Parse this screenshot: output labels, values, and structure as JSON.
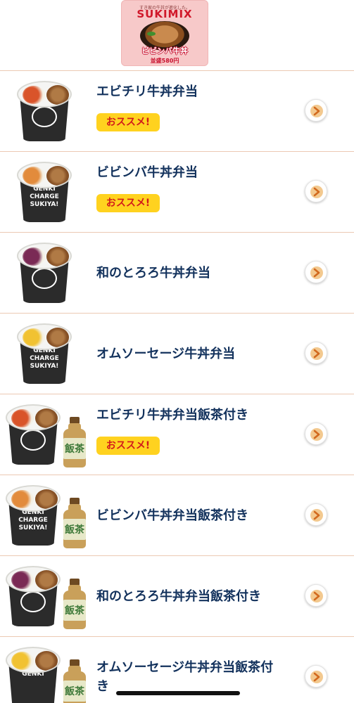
{
  "banner": {
    "tagline": "すき家の牛丼が進化した。",
    "logo": "SUKIMIX",
    "dish": "ビビンバ牛丼",
    "price": "並盛580円"
  },
  "colors": {
    "title": "#12315c",
    "badge_bg": "#ffd21f",
    "badge_text": "#d21a1a",
    "divider": "#ecc9b3"
  },
  "items": [
    {
      "title": "エビチリ牛丼弁当",
      "badge": "おススメ!",
      "left_color": "#d9542a",
      "has_tea": false,
      "cup_text": ""
    },
    {
      "title": "ビビンバ牛丼弁当",
      "badge": "おススメ!",
      "left_color": "#e28b3c",
      "has_tea": false,
      "cup_text": "GENKI\nCHARGE\nSUKIYA!"
    },
    {
      "title": "和のとろろ牛丼弁当",
      "badge": "",
      "left_color": "#7a2a55",
      "has_tea": false,
      "cup_text": ""
    },
    {
      "title": "オムソーセージ牛丼弁当",
      "badge": "",
      "left_color": "#f1c232",
      "has_tea": false,
      "cup_text": "GENKI\nCHARGE\nSUKIYA!"
    },
    {
      "title": "エビチリ牛丼弁当飯茶付き",
      "badge": "おススメ!",
      "left_color": "#d9542a",
      "has_tea": true,
      "cup_text": ""
    },
    {
      "title": "ビビンバ牛丼弁当飯茶付き",
      "badge": "",
      "left_color": "#e28b3c",
      "has_tea": true,
      "cup_text": "GENKI\nCHARGE\nSUKIYA!"
    },
    {
      "title": "和のとろろ牛丼弁当飯茶付き",
      "badge": "",
      "left_color": "#7a2a55",
      "has_tea": true,
      "cup_text": ""
    },
    {
      "title": "オムソーセージ牛丼弁当飯茶付\nき",
      "badge": "",
      "left_color": "#f1c232",
      "has_tea": true,
      "cup_text": "GENKI"
    }
  ],
  "tea_label": "飯茶",
  "icons": {
    "chevron": "chevron-right-icon"
  }
}
